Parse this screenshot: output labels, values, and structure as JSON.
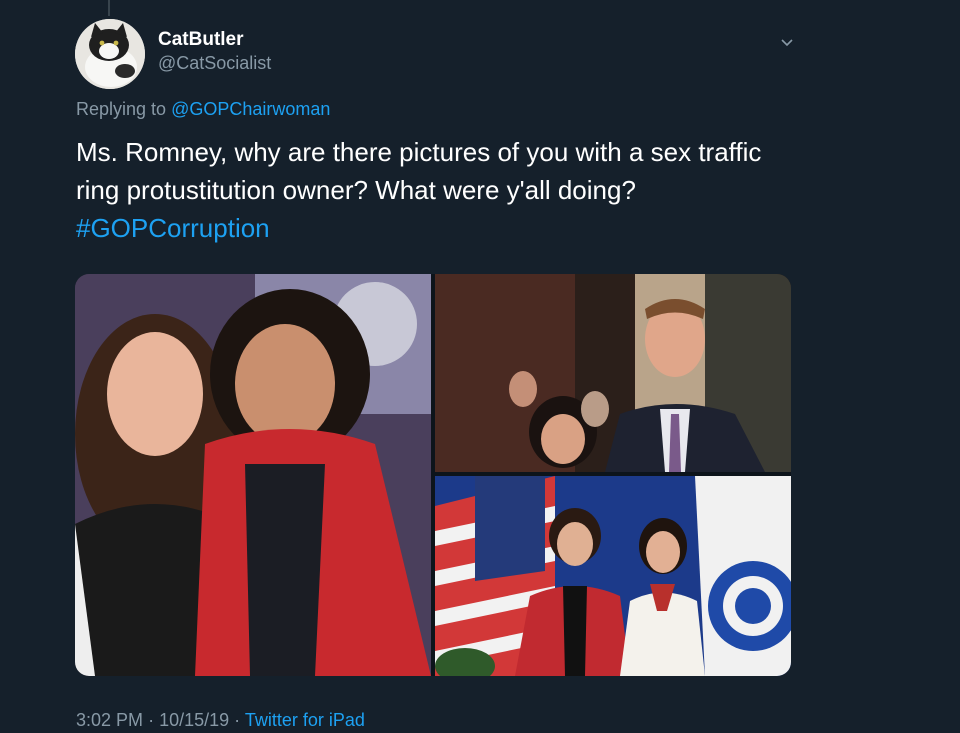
{
  "tweet": {
    "display_name": "CatButler",
    "handle": "@CatSocialist",
    "replying_prefix": "Replying to",
    "replying_to": "@GOPChairwoman",
    "text_line1": "Ms. Romney, why are there pictures of you with a sex traffic",
    "text_line2": "ring protustitution owner? What were y'all doing?",
    "hashtag": "#GOPCorruption",
    "time": "3:02 PM",
    "separator": "·",
    "date": "10/15/19",
    "source": "Twitter for iPad"
  },
  "icons": {
    "avatar": "cat-avatar",
    "menu": "chevron-down-icon"
  },
  "colors": {
    "background": "#15202b",
    "accent": "#1da1f2",
    "secondary_text": "#8899a6"
  }
}
